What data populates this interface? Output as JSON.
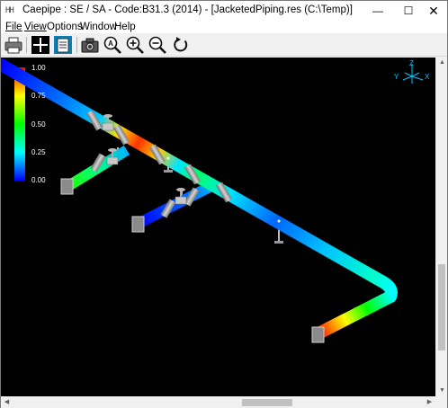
{
  "window": {
    "app_icon": "HH",
    "title": "Caepipe : SE / SA - Code:B31.3 (2014) -  [JacketedPiping.res (C:\\Temp)]",
    "minimize_glyph": "—",
    "maximize_glyph": "☐",
    "close_glyph": "✕"
  },
  "menu": {
    "file": "File",
    "view": "View",
    "options": "Options",
    "window": "Window",
    "help": "Help"
  },
  "toolbar": {
    "icons": [
      "printer-icon",
      "crosshair-icon",
      "notes-icon",
      "camera-icon",
      "zoom-window-icon",
      "zoom-in-icon",
      "zoom-out-icon",
      "reset-view-icon"
    ],
    "zoom_window_letter": "A"
  },
  "legend": {
    "ticks": [
      "1.00",
      "0.75",
      "0.50",
      "0.25",
      "0.00"
    ],
    "top_color": "#ff0000",
    "bottom_color": "#0000ff"
  },
  "axes": {
    "x": "X",
    "y": "Y",
    "z": "Z",
    "color": "#00c8ff"
  },
  "scrollbars": {
    "up": "▲",
    "down": "▼",
    "left": "◀",
    "right": "▶"
  }
}
